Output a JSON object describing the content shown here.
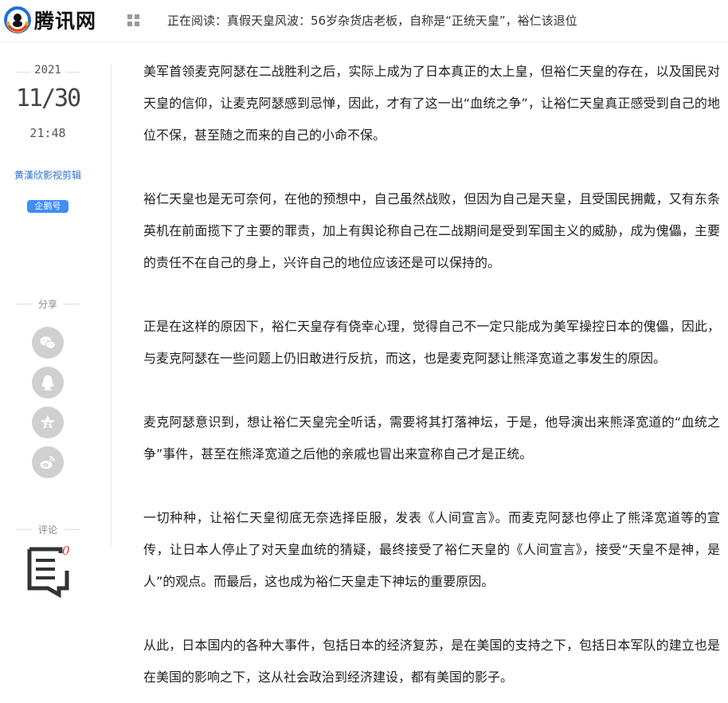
{
  "header": {
    "logo_text": "腾讯网",
    "reading_prefix": "正在阅读：",
    "reading_title": "真假天皇风波：56岁杂货店老板，自称是“正统天皇”，裕仁该退位"
  },
  "sidebar": {
    "year": "2021",
    "day": "11/30",
    "time": "21:48",
    "author": "黄漢欣影视剪辑",
    "badge": "企鹅号",
    "share_label": "分享",
    "share_icons": [
      "wechat-icon",
      "qq-icon",
      "qzone-star-icon",
      "weibo-icon"
    ],
    "comment_label": "评论",
    "comment_count": "0"
  },
  "article": {
    "paragraphs": [
      "美军首领麦克阿瑟在二战胜利之后，实际上成为了日本真正的太上皇，但裕仁天皇的存在，以及国民对天皇的信仰，让麦克阿瑟感到忌惮，因此，才有了这一出“血统之争”，让裕仁天皇真正感受到自己的地位不保，甚至随之而来的自己的小命不保。",
      "裕仁天皇也是无可奈何，在他的预想中，自己虽然战败，但因为自己是天皇，且受国民拥戴，又有东条英机在前面揽下了主要的罪责，加上有舆论称自己在二战期间是受到军国主义的威胁，成为傀儡，主要的责任不在自己的身上，兴许自己的地位应该还是可以保持的。",
      "正是在这样的原因下，裕仁天皇存有侥幸心理，觉得自己不一定只能成为美军操控日本的傀儡，因此，与麦克阿瑟在一些问题上仍旧敢进行反抗，而这，也是麦克阿瑟让熊泽宽道之事发生的原因。",
      "麦克阿瑟意识到，想让裕仁天皇完全听话，需要将其打落神坛，于是，他导演出来熊泽宽道的“血统之争”事件，甚至在熊泽宽道之后他的亲戚也冒出来宣称自己才是正统。",
      "一切种种，让裕仁天皇彻底无奈选择臣服，发表《人间宣言》。而麦克阿瑟也停止了熊泽宽道等的宣传，让日本人停止了对天皇血统的猜疑，最终接受了裕仁天皇的《人间宣言》，接受“天皇不是神，是人”的观点。而最后，这也成为裕仁天皇走下神坛的重要原因。",
      "从此，日本国内的各种大事件，包括日本的经济复苏，是在美国的支持之下，包括日本军队的建立也是在美国的影响之下，这从社会政治到经济建设，都有美国的影子。"
    ]
  },
  "colors": {
    "author_link": "#2b70c9",
    "badge_bg": "#3e8ef7",
    "comment_count": "#e33333",
    "icon_gray": "#d0d0d0"
  }
}
